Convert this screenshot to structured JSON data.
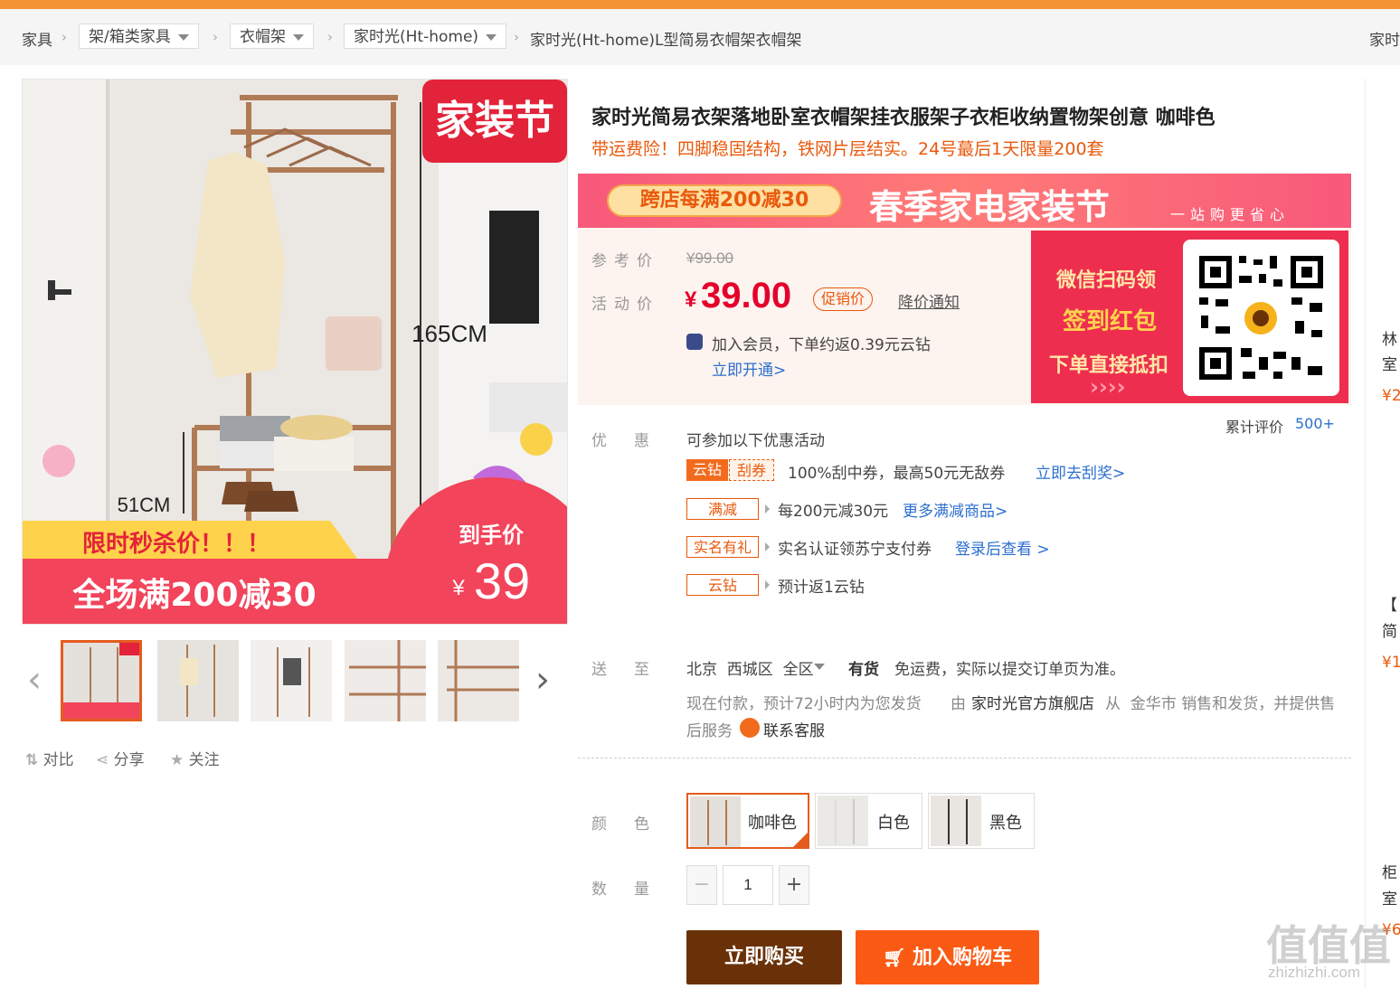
{
  "breadcrumb": {
    "root": "家具",
    "level1": "架/箱类家具",
    "level2": "衣帽架",
    "level3": "家时光(Ht-home)",
    "current": "家时光(Ht-home)L型简易衣帽架衣帽架",
    "right": "家时"
  },
  "gallery": {
    "badge": "家装节",
    "height_label": "165CM",
    "low_label": "51CM",
    "promo_top": "限时秒杀价！！！",
    "promo_bottom": "全场满200减30",
    "hand_price_label": "到手价",
    "hand_price_symbol": "¥",
    "hand_price": "39"
  },
  "tools": {
    "compare": "对比",
    "share": "分享",
    "follow": "关注"
  },
  "product": {
    "title": "家时光简易衣架落地卧室衣帽架挂衣服架子衣柜收纳置物架创意 咖啡色",
    "subtitle": "带运费险！四脚稳固结构，铁网片层结实。24号蕞后1天限量200套"
  },
  "banner": {
    "pill": "跨店每满200减30",
    "headline": "春季家电家装节",
    "tail": "一站购更省心"
  },
  "price": {
    "ref_label": "参考价",
    "ref_value": "¥99.00",
    "act_label": "活动价",
    "currency": "¥",
    "act_value": "39.00",
    "promo_tag": "促销价",
    "notify": "降价通知",
    "member_text": "加入会员，下单约返0.39元云钻",
    "member_link": "立即开通>"
  },
  "qr_panel": {
    "line1": "微信扫码领",
    "line2": "签到红包",
    "line3": "下单直接抵扣",
    "chevrons": "››››"
  },
  "reviews": {
    "label": "累计评价",
    "count": "500+"
  },
  "promotions": {
    "label": "优惠",
    "intro": "可参加以下优惠活动",
    "items": [
      {
        "tag_a": "云钻",
        "tag_b": "刮券",
        "text": "100%刮中券，最高50元无敌券",
        "link": "立即去刮奖>"
      },
      {
        "tag": "满减",
        "text": "每200元减30元",
        "link": "更多满减商品>"
      },
      {
        "tag": "实名有礼",
        "text": "实名认证领苏宁支付券",
        "link": "登录后查看 >"
      },
      {
        "tag": "云钻",
        "text": "预计返1云钻",
        "link": ""
      }
    ]
  },
  "delivery": {
    "label": "送至",
    "location": "北京  西城区  全区",
    "stock": "有货",
    "fee": "免运费，实际以提交订单页为准。",
    "line2_a": "现在付款，预计72小时内为您发货",
    "line2_b": "由",
    "store": "家时光官方旗舰店",
    "line2_c": "从  金华市 销售和发货，并提供售",
    "line3": "后服务",
    "service": "联系客服"
  },
  "color": {
    "label": "颜色",
    "options": [
      "咖啡色",
      "白色",
      "黑色"
    ],
    "selected": "咖啡色"
  },
  "quantity": {
    "label": "数量",
    "value": "1",
    "minus": "−",
    "plus": "+"
  },
  "actions": {
    "buy": "立即购买",
    "cart": "加入购物车"
  },
  "sidebar": {
    "items": [
      {
        "line1": "林",
        "line2": "室",
        "price": "¥2"
      },
      {
        "line1": "【",
        "line2": "简",
        "price": "¥1"
      },
      {
        "line1": "柜",
        "line2": "室",
        "price": "¥6"
      }
    ]
  },
  "watermark": {
    "text": "值值值",
    "url": "zhizhizhi.com"
  },
  "colors": {
    "accent": "#f29434",
    "price_red": "#e4002b",
    "buy": "#6a3108",
    "cart": "#fa5a13",
    "link": "#2b6fcf"
  }
}
